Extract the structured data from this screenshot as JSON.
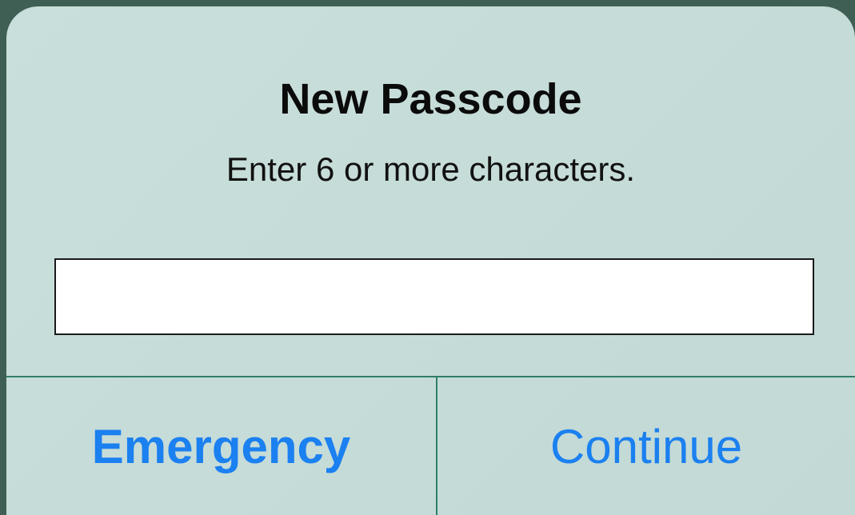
{
  "alert": {
    "title": "New Passcode",
    "message": "Enter 6 or more characters.",
    "passcode_field": {
      "value": "",
      "placeholder": ""
    },
    "buttons": {
      "emergency_label": "Emergency",
      "continue_label": "Continue"
    }
  },
  "colors": {
    "accent": "#1b80f0",
    "divider": "#2f7f6a",
    "background": "#c6dcd8"
  }
}
